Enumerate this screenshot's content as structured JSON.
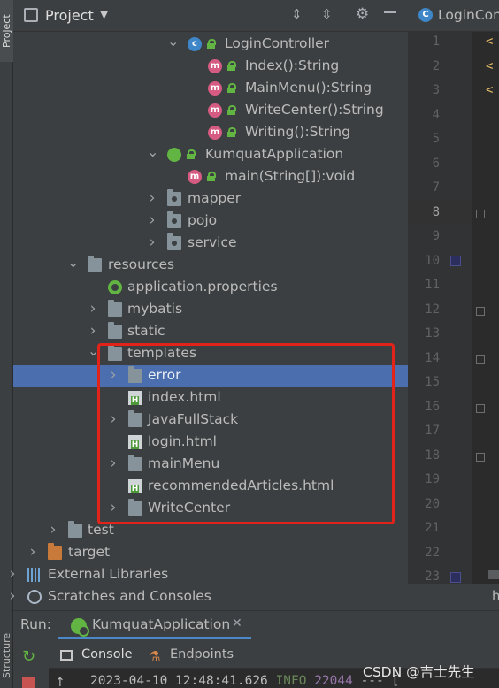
{
  "left_strip": {
    "project_tab": "Project",
    "structure_tab": "Structure"
  },
  "project_panel": {
    "title": "Project",
    "tree": [
      {
        "label": "LoginController",
        "icon": "class-icon",
        "expanded": true,
        "chevron": "open"
      },
      {
        "label": "Index():String",
        "icon": "method-icon"
      },
      {
        "label": "MainMenu():String",
        "icon": "method-icon"
      },
      {
        "label": "WriteCenter():String",
        "icon": "method-icon"
      },
      {
        "label": "Writing():String",
        "icon": "method-icon"
      },
      {
        "label": "KumquatApplication",
        "icon": "spring-boot-icon",
        "expanded": true,
        "chevron": "open"
      },
      {
        "label": "main(String[]):void",
        "icon": "method-icon"
      },
      {
        "label": "mapper",
        "icon": "package-icon",
        "chevron": "closed"
      },
      {
        "label": "pojo",
        "icon": "package-icon",
        "chevron": "closed"
      },
      {
        "label": "service",
        "icon": "package-icon",
        "chevron": "closed"
      },
      {
        "label": "resources",
        "icon": "resources-folder-icon",
        "chevron": "open"
      },
      {
        "label": "application.properties",
        "icon": "properties-file-icon"
      },
      {
        "label": "mybatis",
        "icon": "folder-icon",
        "chevron": "closed"
      },
      {
        "label": "static",
        "icon": "folder-icon",
        "chevron": "closed"
      },
      {
        "label": "templates",
        "icon": "folder-icon",
        "chevron": "open"
      },
      {
        "label": "error",
        "icon": "folder-icon",
        "chevron": "closed",
        "selected": true
      },
      {
        "label": "index.html",
        "icon": "html-file-icon"
      },
      {
        "label": "JavaFullStack",
        "icon": "folder-icon",
        "chevron": "closed"
      },
      {
        "label": "login.html",
        "icon": "html-file-icon"
      },
      {
        "label": "mainMenu",
        "icon": "folder-icon",
        "chevron": "closed"
      },
      {
        "label": "recommendedArticles.html",
        "icon": "html-file-icon"
      },
      {
        "label": "WriteCenter",
        "icon": "folder-icon",
        "chevron": "closed"
      },
      {
        "label": "test",
        "icon": "folder-icon",
        "chevron": "closed"
      },
      {
        "label": "target",
        "icon": "excluded-folder-icon",
        "chevron": "closed"
      },
      {
        "label": "External Libraries",
        "icon": "libraries-icon",
        "chevron": "closed"
      },
      {
        "label": "Scratches and Consoles",
        "icon": "scratches-icon",
        "chevron": "closed"
      }
    ]
  },
  "editor": {
    "tab_label": "LoginCon",
    "line_numbers": [
      "1",
      "2",
      "3",
      "4",
      "5",
      "6",
      "7",
      "8",
      "9",
      "10",
      "11",
      "12",
      "13",
      "14",
      "15",
      "16",
      "17",
      "18",
      "19",
      "20",
      "21",
      "22",
      "23"
    ],
    "current_line": "8",
    "code_glyphs": [
      "<",
      "<",
      "<"
    ],
    "bottom_text": "h"
  },
  "run_panel": {
    "label": "Run:",
    "tab_label": "KumquatApplication",
    "close_glyph": "✕",
    "console_tab": "Console",
    "endpoints_tab": "Endpoints",
    "log": {
      "timestamp": "2023-04-10 12:48:41.626",
      "level": "INFO",
      "pid": "22044",
      "separator": "--- ["
    }
  },
  "watermark": "CSDN @吉士先生",
  "colors": {
    "selection": "#4b6eaf",
    "annotation_box": "#e2231a",
    "panel_bg": "#3c3f41",
    "editor_bg": "#2b2b2b"
  }
}
